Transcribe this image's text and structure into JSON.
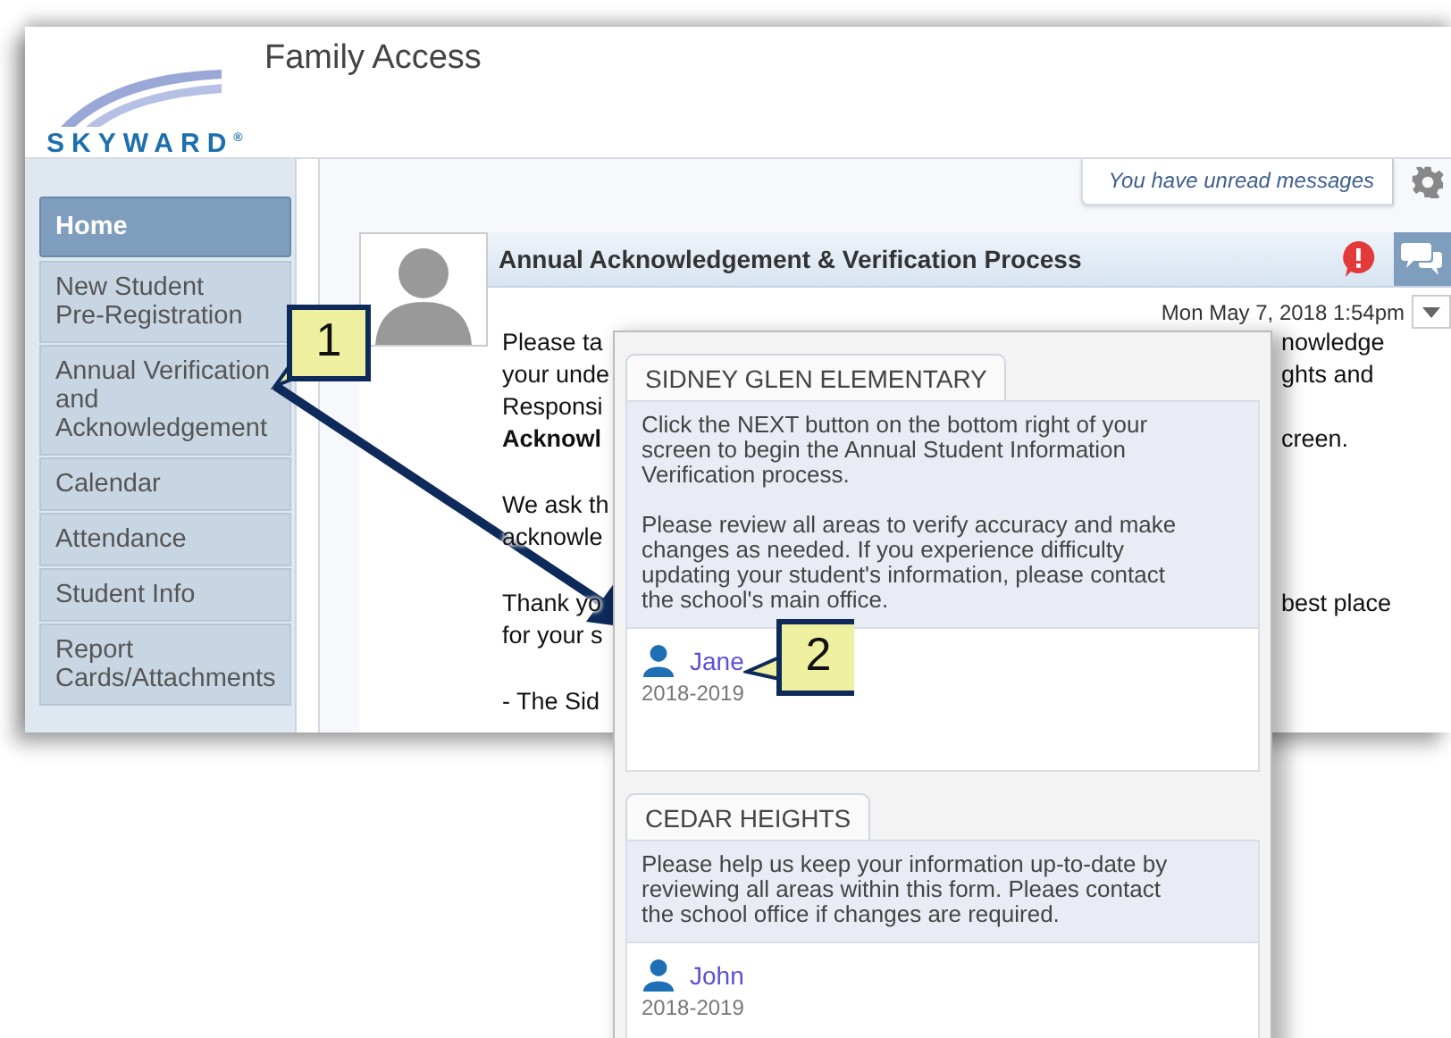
{
  "app": {
    "logo": "SKYWARD$^{®}$",
    "title": "Family Access"
  },
  "messages_bar": {
    "text": "You have unread messages"
  },
  "nav": [
    {
      "label": "Home",
      "selected": true
    },
    {
      "label": "New Student Pre-Registration",
      "selected": false
    },
    {
      "label": "Annual Verification and Acknowledgement",
      "selected": false
    },
    {
      "label": "Calendar",
      "selected": false
    },
    {
      "label": "Attendance",
      "selected": false
    },
    {
      "label": "Student Info",
      "selected": false
    },
    {
      "label": "Report Cards/Attachments",
      "selected": false
    }
  ],
  "message": {
    "title": "Annual Acknowledgement & Verification Process",
    "date": "Mon May 7, 2018 1:54pm",
    "paragraphs": [
      [
        {
          "left": "Please ta",
          "right": "nowledge"
        },
        {
          "left": "your unde",
          "right": "ghts and"
        },
        {
          "left": "Responsi"
        },
        {
          "left": "**Acknowl**",
          "right": "creen."
        }
      ],
      [
        {
          "left": "We ask th"
        },
        {
          "left": "acknowle"
        }
      ],
      [
        {
          "left": "Thank yo",
          "right": "best place"
        },
        {
          "left": "for your s"
        }
      ],
      [
        {
          "left": "- The Sid"
        }
      ]
    ]
  },
  "popup": {
    "schools": [
      {
        "name": "SIDNEY GLEN ELEMENTARY",
        "paragraphs": [
          "Click the NEXT button on the bottom right of your screen to begin the Annual Student Information Verification process.",
          "Please review all areas to verify accuracy and make changes as needed. If you experience difficulty updating your student's information, please contact the school's main office."
        ],
        "students": [
          {
            "name": "Jane",
            "year": "2018-2019"
          }
        ]
      },
      {
        "name": "CEDAR HEIGHTS",
        "paragraphs": [
          "Please help us keep your information up-to-date by reviewing all areas within this form. Pleaes contact the school office if changes are required."
        ],
        "students": [
          {
            "name": "John",
            "year": "2018-2019"
          }
        ]
      }
    ]
  },
  "callouts": [
    "1",
    "2"
  ]
}
